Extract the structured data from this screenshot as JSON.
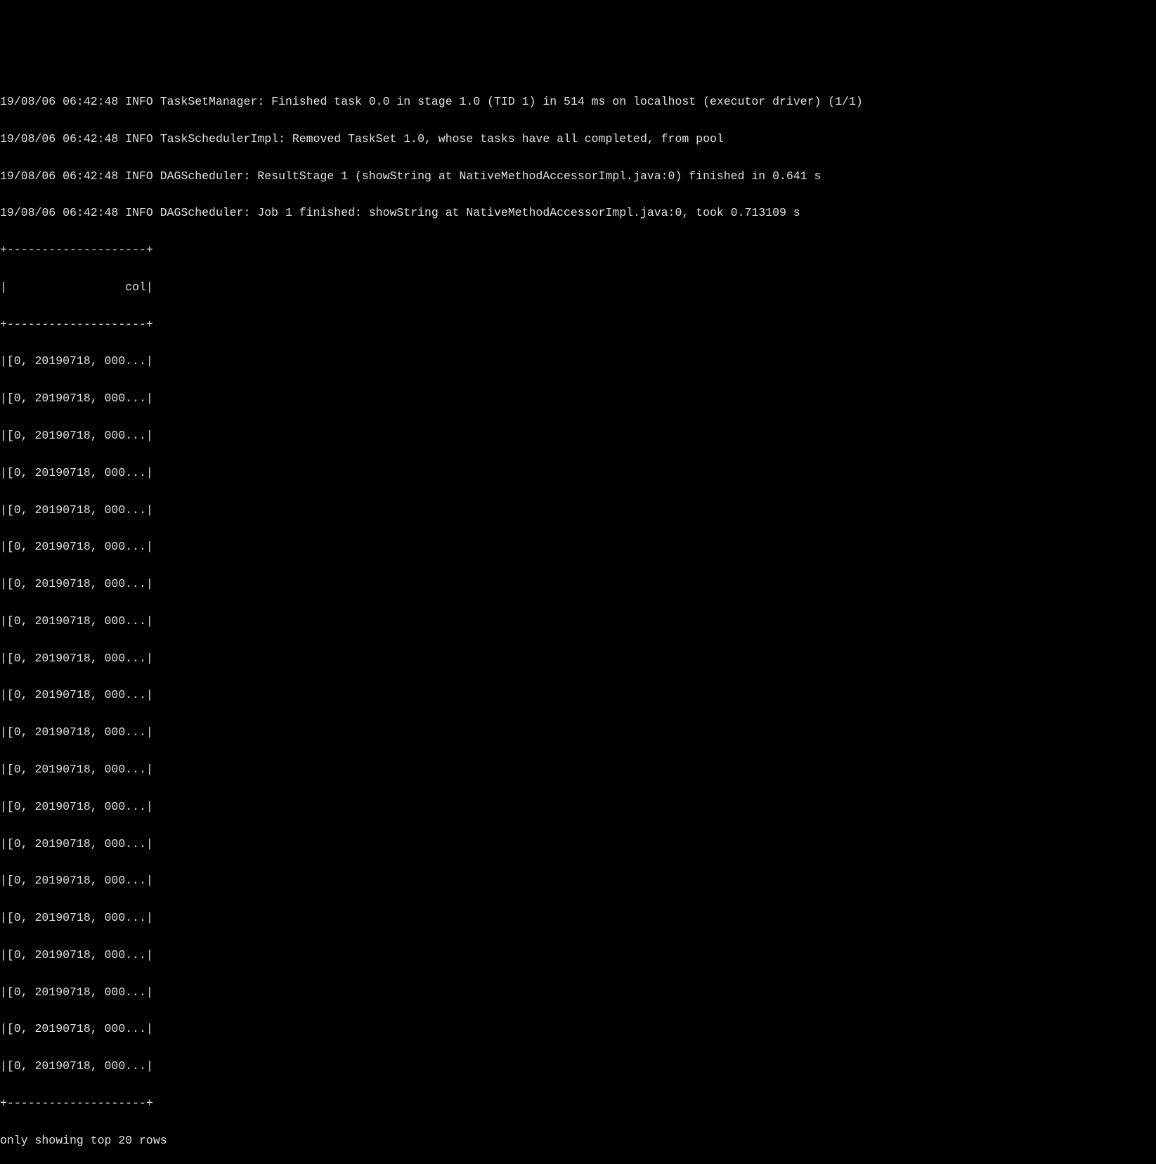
{
  "logs": [
    "19/08/06 06:42:48 INFO TaskSetManager: Finished task 0.0 in stage 1.0 (TID 1) in 514 ms on localhost (executor driver) (1/1)",
    "19/08/06 06:42:48 INFO TaskSchedulerImpl: Removed TaskSet 1.0, whose tasks have all completed, from pool",
    "19/08/06 06:42:48 INFO DAGScheduler: ResultStage 1 (showString at NativeMethodAccessorImpl.java:0) finished in 0.641 s",
    "19/08/06 06:42:48 INFO DAGScheduler: Job 1 finished: showString at NativeMethodAccessorImpl.java:0, took 0.713109 s"
  ],
  "table": {
    "border": "+--------------------+",
    "header": "|                 col|",
    "rows": [
      "|[0, 20190718, 000...|",
      "|[0, 20190718, 000...|",
      "|[0, 20190718, 000...|",
      "|[0, 20190718, 000...|",
      "|[0, 20190718, 000...|",
      "|[0, 20190718, 000...|",
      "|[0, 20190718, 000...|",
      "|[0, 20190718, 000...|",
      "|[0, 20190718, 000...|",
      "|[0, 20190718, 000...|",
      "|[0, 20190718, 000...|",
      "|[0, 20190718, 000...|",
      "|[0, 20190718, 000...|",
      "|[0, 20190718, 000...|",
      "|[0, 20190718, 000...|",
      "|[0, 20190718, 000...|",
      "|[0, 20190718, 000...|",
      "|[0, 20190718, 000...|",
      "|[0, 20190718, 000...|",
      "|[0, 20190718, 000...|"
    ]
  },
  "footer": "only showing top 20 rows"
}
